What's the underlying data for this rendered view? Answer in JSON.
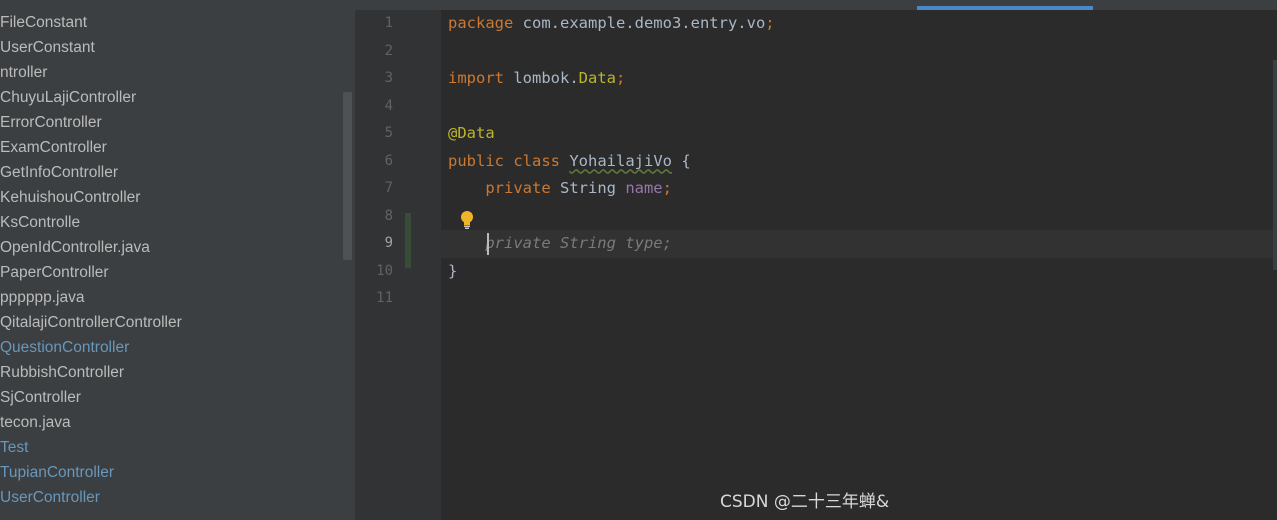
{
  "sidebar": {
    "items": [
      {
        "label": "FileConstant",
        "color": "#bbbbbb"
      },
      {
        "label": "UserConstant",
        "color": "#bbbbbb"
      },
      {
        "label": "ntroller",
        "color": "#bbbbbb"
      },
      {
        "label": "ChuyuLajiController",
        "color": "#bbbbbb"
      },
      {
        "label": "ErrorController",
        "color": "#bbbbbb"
      },
      {
        "label": "ExamController",
        "color": "#bbbbbb"
      },
      {
        "label": "GetInfoController",
        "color": "#bbbbbb"
      },
      {
        "label": "KehuishouController",
        "color": "#bbbbbb"
      },
      {
        "label": "KsControlle",
        "color": "#bbbbbb"
      },
      {
        "label": "OpenIdController.java",
        "color": "#bbbbbb"
      },
      {
        "label": "PaperController",
        "color": "#bbbbbb"
      },
      {
        "label": "pppppp.java",
        "color": "#bbbbbb"
      },
      {
        "label": "QitalajiControllerController",
        "color": "#bbbbbb"
      },
      {
        "label": "QuestionController",
        "color": "#6897bb"
      },
      {
        "label": "RubbishController",
        "color": "#bbbbbb"
      },
      {
        "label": "SjController",
        "color": "#bbbbbb"
      },
      {
        "label": "tecon.java",
        "color": "#bbbbbb"
      },
      {
        "label": "Test",
        "color": "#6897bb"
      },
      {
        "label": "TupianController",
        "color": "#6897bb"
      },
      {
        "label": "UserController",
        "color": "#6897bb"
      }
    ]
  },
  "editor": {
    "line_numbers": [
      "1",
      "2",
      "3",
      "4",
      "5",
      "6",
      "7",
      "8",
      "9",
      "10",
      "11"
    ],
    "current_line": "9",
    "code": {
      "l1_kw": "package",
      "l1_text": " com.example.demo3.entry.vo",
      "l1_semi": ";",
      "l3_kw": "import",
      "l3_text": " lombok.",
      "l3_cls": "Data",
      "l3_semi": ";",
      "l5_annot": "@Data",
      "l6_kw": "public class",
      "l6_sp": " ",
      "l6_cls": "YohailajiVo",
      "l6_rest": " {",
      "l7_indent": "    ",
      "l7_kw": "private",
      "l7_type": " String ",
      "l7_field": "name",
      "l7_semi": ";",
      "l9_indent": "    ",
      "l9_hint": "private String type;",
      "l10": "}"
    },
    "icons": {
      "intention": "lightbulb-icon"
    }
  },
  "watermark": "CSDN @二十三年蝉&"
}
